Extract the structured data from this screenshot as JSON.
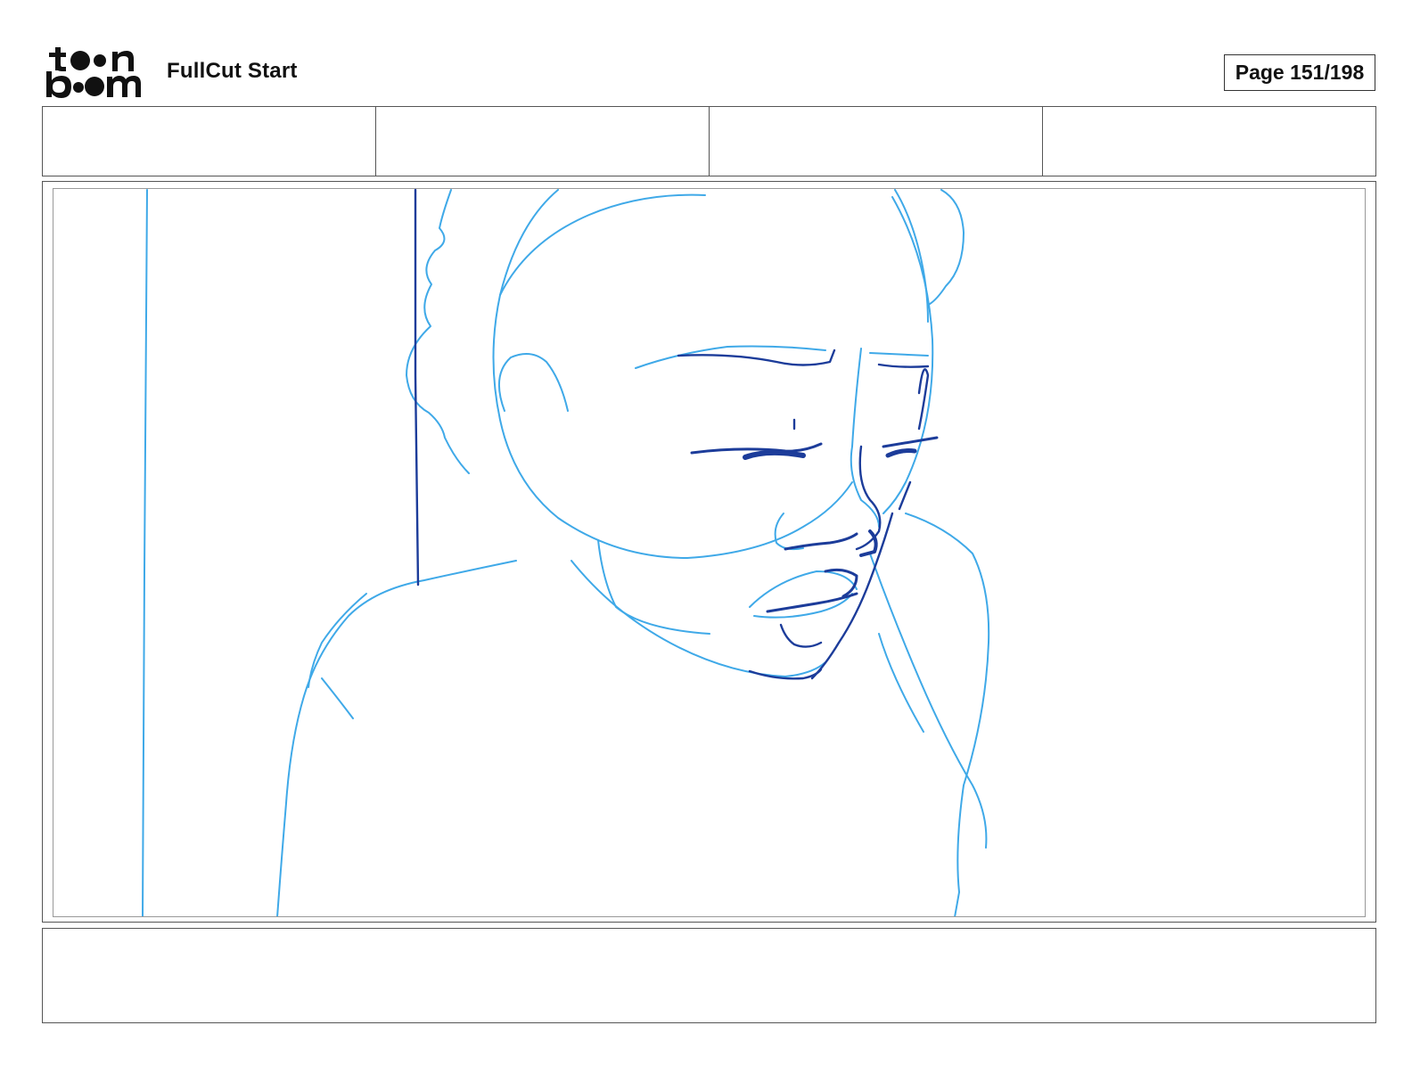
{
  "header": {
    "logo_text_line1": "toon",
    "logo_text_line2": "boom",
    "title": "FullCut Start",
    "page_label": "Page 151/198"
  },
  "info_cells": [
    "",
    "",
    "",
    ""
  ],
  "panel": {
    "sketch_colors": {
      "light_blue": "#3fa9e8",
      "dark_blue": "#1c3c9a"
    }
  },
  "notes": {
    "text": ""
  }
}
